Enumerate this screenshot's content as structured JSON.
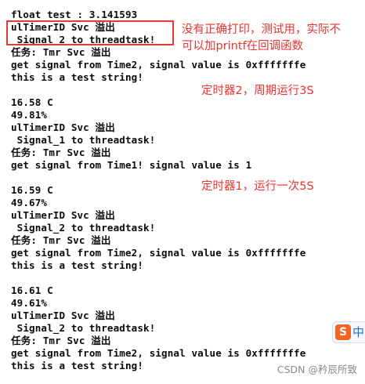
{
  "terminal": {
    "lines": [
      "float test : 3.141593",
      "ulTimerID Svc 溢出",
      " Signal_2 to threadtask!",
      "任务: Tmr Svc 溢出",
      "get signal from Time2, signal value is 0xfffffffe",
      "this is a test string!",
      "",
      "16.58 C",
      "49.81%",
      "ulTimerID Svc 溢出",
      " Signal_1 to threadtask!",
      "任务: Tmr Svc 溢出",
      "get signal from Time1! signal value is 1",
      "",
      "16.59 C",
      "49.67%",
      "ulTimerID Svc 溢出",
      " Signal_2 to threadtask!",
      "任务: Tmr Svc 溢出",
      "get signal from Time2, signal value is 0xfffffffe",
      "this is a test string!",
      "",
      "16.61 C",
      "49.61%",
      "ulTimerID Svc 溢出",
      " Signal_2 to threadtask!",
      "任务: Tmr Svc 溢出",
      "get signal from Time2, signal value is 0xfffffffe",
      "this is a test string!"
    ]
  },
  "annotations": {
    "note_print_line1": "没有正确打印，测试用，实际不",
    "note_print_line2": "可以加printf在回调函数",
    "timer2_note": "定时器2，周期运行3S",
    "timer1_note": "定时器1，运行一次5S"
  },
  "colors": {
    "annotation_text": "#e8332f",
    "highlight_box": "#e53935",
    "terminal_text": "#0b0b0b"
  },
  "ime_toolbar": {
    "logo_letter": "S",
    "mode_label": "中",
    "icon": "sogou-ime-icon"
  },
  "watermark": "CSDN @矜辰所致"
}
